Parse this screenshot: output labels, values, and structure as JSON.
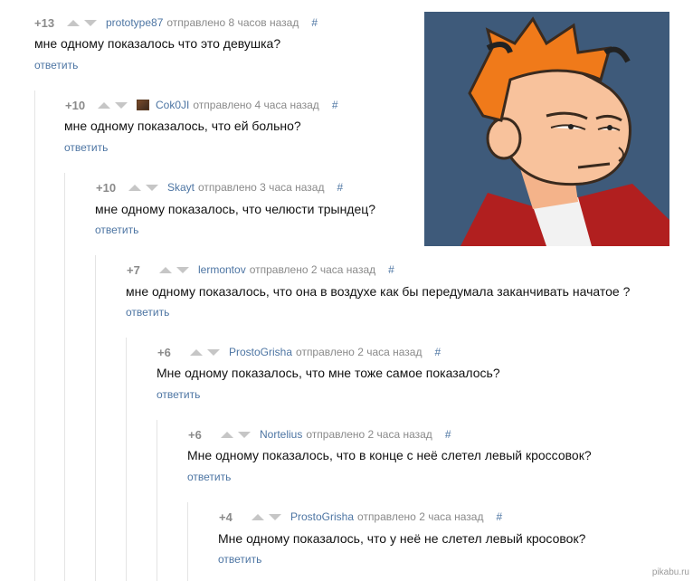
{
  "comments": [
    {
      "rating": "+13",
      "author": "prototype87",
      "sent": "отправлено 8 часов назад",
      "hash": "#",
      "text": "мне одному показалось что это девушка?",
      "reply": "ответить"
    },
    {
      "rating": "+10",
      "author": "Cok0JI",
      "sent": "отправлено 4 часа назад",
      "hash": "#",
      "text": "мне одному показалось, что ей больно?",
      "reply": "ответить"
    },
    {
      "rating": "+10",
      "author": "Skayt",
      "sent": "отправлено 3 часа назад",
      "hash": "#",
      "text": "мне одному показалось, что челюсти трындец?",
      "reply": "ответить"
    },
    {
      "rating": "+7",
      "author": "lermontov",
      "sent": "отправлено 2 часа назад",
      "hash": "#",
      "text": "мне одному показалось, что она в воздухе как бы передумала заканчивать начатое ?",
      "reply": "ответить"
    },
    {
      "rating": "+6",
      "author": "ProstoGrisha",
      "sent": "отправлено 2 часа назад",
      "hash": "#",
      "text": "Мне одному показалось, что мне тоже самое показалось?",
      "reply": "ответить"
    },
    {
      "rating": "+6",
      "author": "Nortelius",
      "sent": "отправлено 2 часа назад",
      "hash": "#",
      "text": "Мне одному показалось, что в конце с неё слетел левый кроссовок?",
      "reply": "ответить"
    },
    {
      "rating": "+4",
      "author": "ProstoGrisha",
      "sent": "отправлено 2 часа назад",
      "hash": "#",
      "text": "Мне одному показалось, что у неё не слетел левый кросовок?",
      "reply": "ответить"
    }
  ],
  "watermark": "pikabu.ru",
  "colors": {
    "link": "#4d75a3",
    "rating": "#8a8a8a",
    "text": "#111111",
    "line": "#e4e4e4",
    "meme_bg": "#3d5878"
  },
  "icons": {
    "vote_up": "triangle-up",
    "vote_down": "triangle-down",
    "avatar": "user-avatar-icon"
  }
}
